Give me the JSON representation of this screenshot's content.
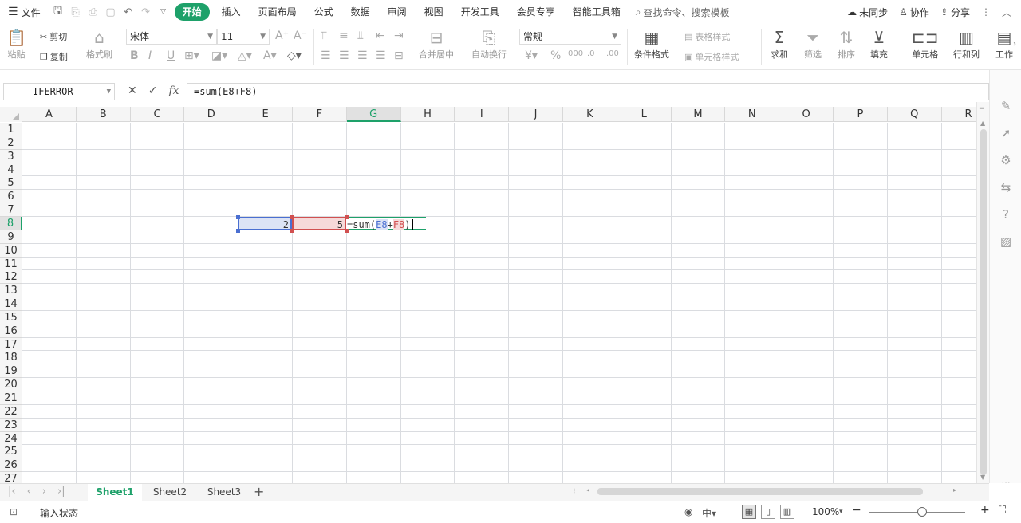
{
  "menubar": {
    "file_label": "文件",
    "tabs": [
      "开始",
      "插入",
      "页面布局",
      "公式",
      "数据",
      "审阅",
      "视图",
      "开发工具",
      "会员专享",
      "智能工具箱"
    ],
    "active_tab": "开始",
    "search_placeholder": "查找命令、搜索模板",
    "sync_label": "未同步",
    "collab_label": "协作",
    "share_label": "分享"
  },
  "ribbon": {
    "paste_label": "粘贴",
    "cut_label": "剪切",
    "copy_label": "复制",
    "format_painter_label": "格式刷",
    "font_name": "宋体",
    "font_size": "11",
    "merge_center_label": "合并居中",
    "wrap_text_label": "自动换行",
    "number_format": "常规",
    "conditional_format_label": "条件格式",
    "table_style_label": "表格样式",
    "cell_style_label": "单元格样式",
    "sum_label": "求和",
    "filter_label": "筛选",
    "sort_label": "排序",
    "fill_label": "填充",
    "cell_label": "单元格",
    "row_col_label": "行和列",
    "worksheet_label": "工作"
  },
  "formula_bar": {
    "name_box": "IFERROR",
    "formula": "=sum(E8+F8)"
  },
  "grid": {
    "columns": [
      "A",
      "B",
      "C",
      "D",
      "E",
      "F",
      "G",
      "H",
      "I",
      "J",
      "K",
      "L",
      "M",
      "N",
      "O",
      "P",
      "Q",
      "R"
    ],
    "rows": [
      "1",
      "2",
      "3",
      "4",
      "5",
      "6",
      "7",
      "8",
      "9",
      "10",
      "11",
      "12",
      "13",
      "14",
      "15",
      "16",
      "17",
      "18",
      "19",
      "20",
      "21",
      "22",
      "23",
      "24",
      "25",
      "26",
      "27"
    ],
    "active_column": "G",
    "active_row": "8",
    "cells": {
      "E8": "2",
      "F8": "5",
      "G8_prefix": "=sum(",
      "G8_ref1": "E8",
      "G8_plus": "+",
      "G8_ref2": "F8",
      "G8_suffix": ")"
    }
  },
  "sheets": [
    "Sheet1",
    "Sheet2",
    "Sheet3"
  ],
  "active_sheet": "Sheet1",
  "status": {
    "mode": "输入状态",
    "zoom": "100%"
  },
  "colors": {
    "accent": "#1ea16a",
    "ref1_fill": "#dce3f5",
    "ref1_border": "#4a6fd1",
    "ref2_fill": "#f6d9d9",
    "ref2_border": "#d15050"
  }
}
